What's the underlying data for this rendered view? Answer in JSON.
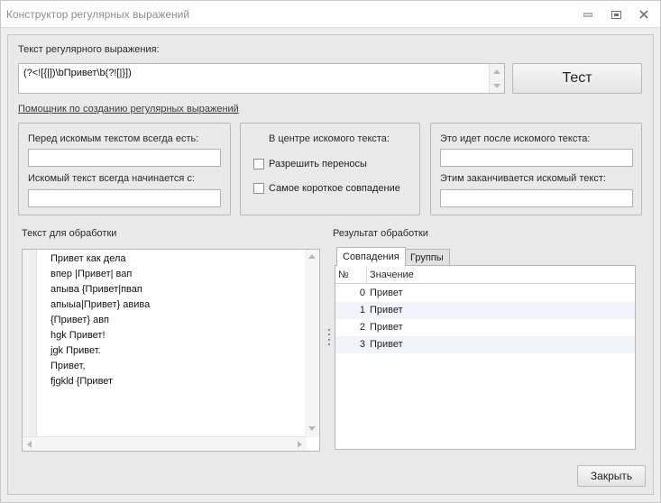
{
  "window": {
    "title": "Конструктор регулярных выражений",
    "controls": {
      "minimize": "▭",
      "maximize": "▣",
      "close": "✕"
    }
  },
  "regex": {
    "label": "Текст регулярного выражения:",
    "value": "(?<![{|])\\bПривет\\b(?![|}])"
  },
  "test_button": "Тест",
  "helper_link": "Помощник по созданию регулярных выражений",
  "helper": {
    "before": {
      "label_always": "Перед искомым текстом всегда есть:",
      "label_starts": "Искомый текст всегда начинается с:"
    },
    "center": {
      "label": "В центре искомого текста:",
      "allow_breaks": "Разрешить переносы",
      "shortest_match": "Самое короткое совпадение"
    },
    "after": {
      "label_after": "Это идет после искомого текста:",
      "label_ends": "Этим заканчивается искомый текст:"
    }
  },
  "input_text": {
    "label": "Текст для обработки",
    "lines": [
      "Привет как дела",
      "впер |Привет| вап",
      "апыва {Привет|пвап",
      "апыыа|Привет} авива",
      "{Привет} авп",
      "hgk Привет!",
      "jgk Привет.",
      "Привет,",
      "fjgkld {Привет"
    ]
  },
  "result": {
    "label": "Результат обработки",
    "tabs": [
      "Совпадения",
      "Группы"
    ],
    "columns": [
      "№",
      "Значение"
    ],
    "rows": [
      {
        "index": "0",
        "value": "Привет"
      },
      {
        "index": "1",
        "value": "Привет"
      },
      {
        "index": "2",
        "value": "Привет"
      },
      {
        "index": "3",
        "value": "Привет"
      }
    ]
  },
  "close_button": "Закрыть",
  "colors": {
    "window_bg": "#eeeeee",
    "row_alt": "#f0f4f9",
    "border": "#b9b9b9"
  }
}
